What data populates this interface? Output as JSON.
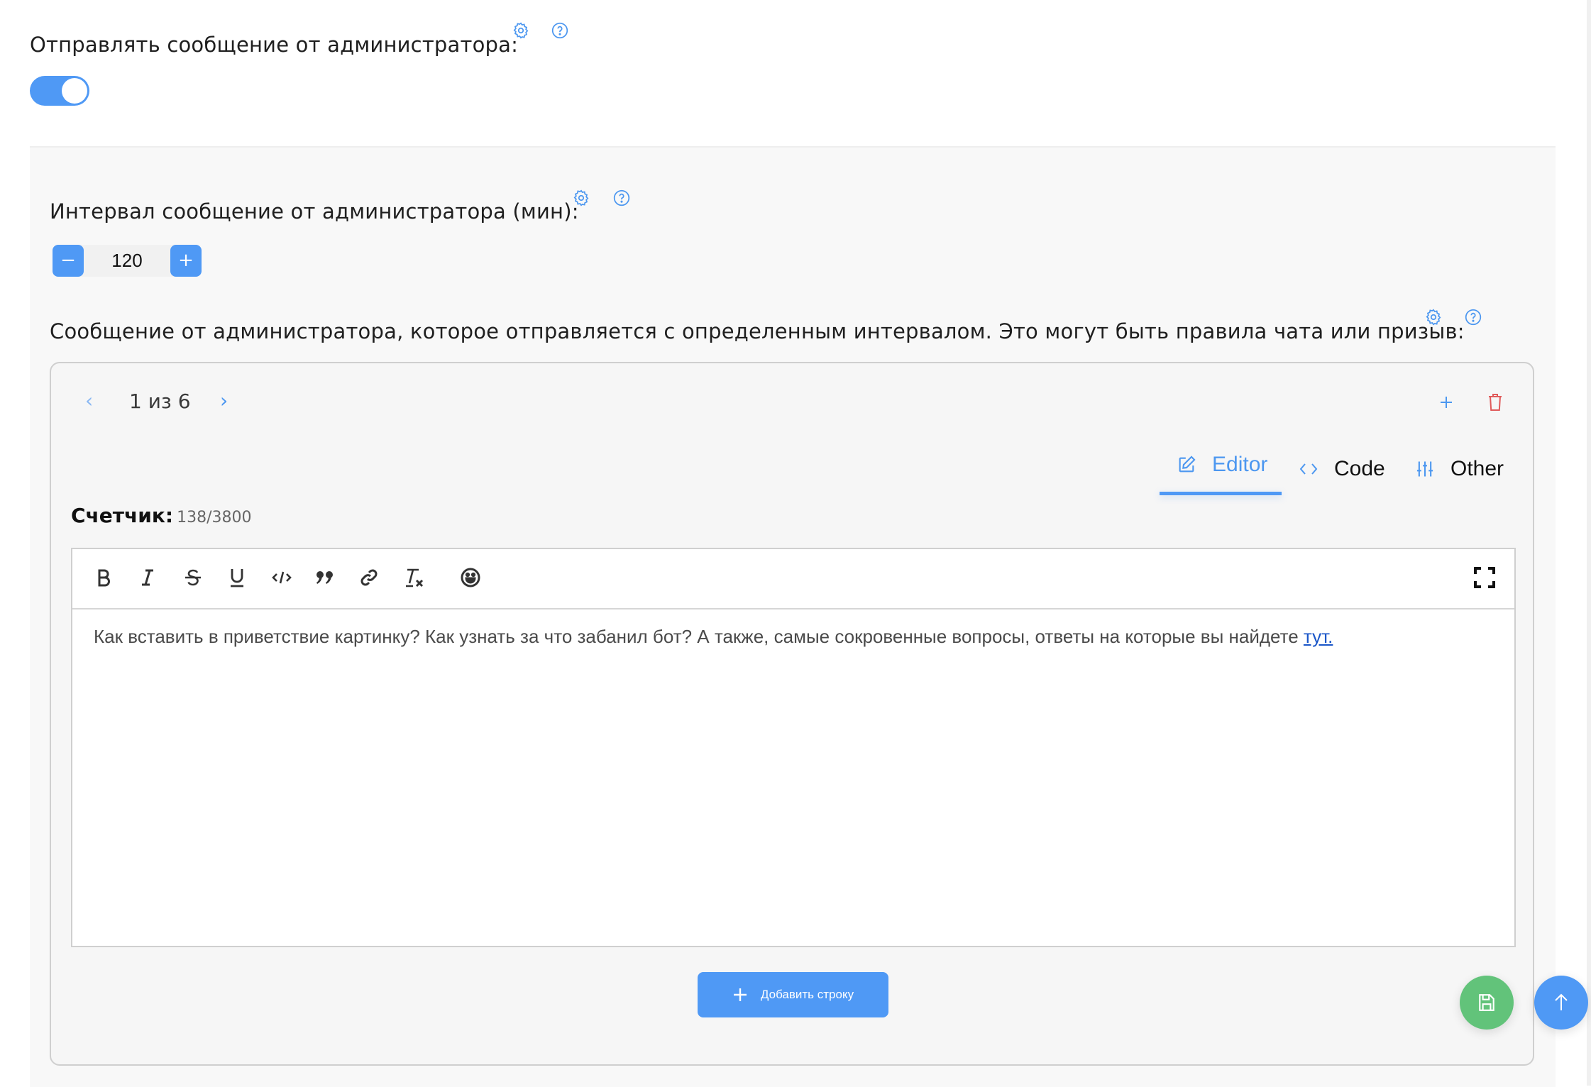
{
  "send_admin_message": {
    "label": "Отправлять сообщение от администратора:",
    "toggle_on": true
  },
  "interval": {
    "label": "Интервал сообщение от администратора (мин):",
    "value": "120",
    "minus_label": "−",
    "plus_label": "+"
  },
  "message": {
    "label": "Сообщение от администратора, которое отправляется с определенным интервалом. Это могут быть правила чата или призыв:",
    "pager": {
      "prev": "‹",
      "text": "1 из 6",
      "next": "›"
    },
    "tabs": [
      {
        "label": "Editor",
        "icon": "edit-icon",
        "active": true
      },
      {
        "label": "Code",
        "icon": "code-icon",
        "active": false
      },
      {
        "label": "Other",
        "icon": "sliders-icon",
        "active": false
      }
    ],
    "counter": {
      "label": "Счетчик:",
      "value": "138/3800"
    },
    "toolbar": [
      "bold",
      "italic",
      "strikethrough",
      "underline",
      "code",
      "quote",
      "link",
      "clear-format",
      "emoji"
    ],
    "text_before_link": "Как вставить в приветствие картинку? Как узнать за что забанил бот?  А также, самые сокровенные вопросы, ответы на которые вы найдете ",
    "link_text": "тут.",
    "add_row_label": "Добавить строку"
  },
  "colors": {
    "accent": "#4f99f5",
    "save": "#62c37a",
    "danger": "#e05a5a",
    "link": "#1a56c8"
  }
}
